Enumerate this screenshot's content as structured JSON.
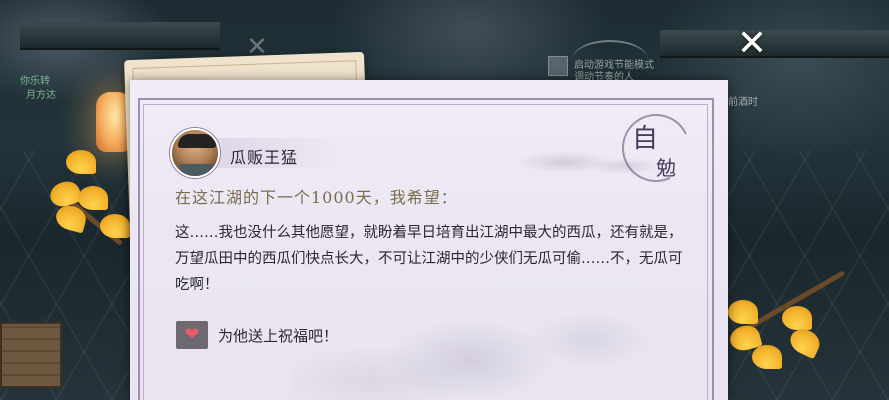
{
  "scene": {
    "hud_left": "你乐转",
    "hud_left_sub": "月方达",
    "hud_center": "启动游戏节能模式",
    "hud_center_sub": "调动节奏的人",
    "tag_right": "前酒时"
  },
  "close_symbol": "✕",
  "background_close_symbol": "✕",
  "card": {
    "npc_name": "瓜贩王猛",
    "seal_chars": [
      "自",
      "勉"
    ],
    "prompt": "在这江湖的下一个1000天，我希望：",
    "wish_text": "这……我也没什么其他愿望，就盼着早日培育出江湖中最大的西瓜，还有就是，万望瓜田中的西瓜们快点长大，不可让江湖中的少侠们无瓜可偷……不，无瓜可吃啊！",
    "bless_icon": "heart-icon",
    "bless_icon_glyph": "❤",
    "bless_label": "为他送上祝福吧！"
  },
  "colors": {
    "prompt_gold": "#7a6c4e",
    "text_dark": "#2a2636",
    "heart_red": "#e85b6b",
    "frame_purple": "#9a90ab"
  }
}
